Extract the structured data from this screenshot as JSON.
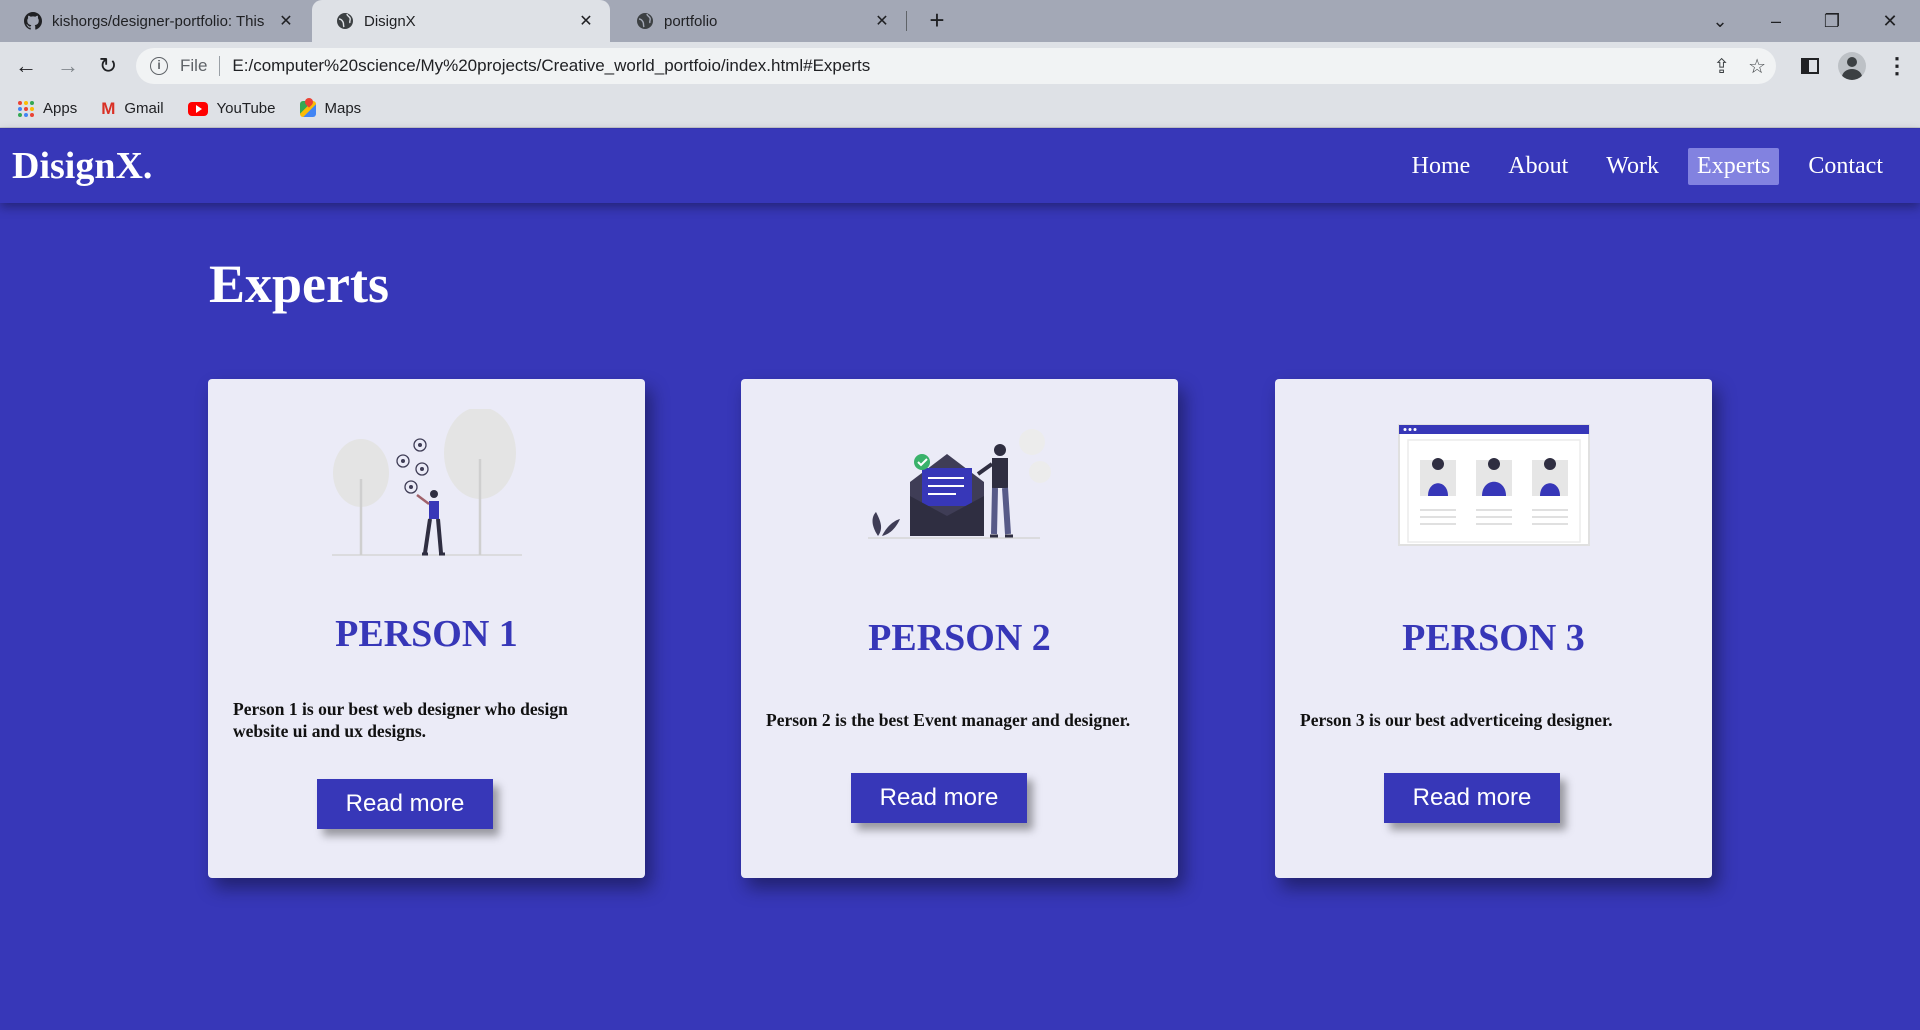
{
  "browser": {
    "tabs": [
      {
        "title": "kishorgs/designer-portfolio: This",
        "icon": "github-icon"
      },
      {
        "title": "DisignX",
        "icon": "globe-icon"
      },
      {
        "title": "portfolio",
        "icon": "globe-icon"
      }
    ],
    "address": {
      "scheme_label": "File",
      "url": "E:/computer%20science/My%20projects/Creative_world_portfoio/index.html#Experts"
    },
    "bookmarks": [
      {
        "label": "Apps",
        "icon": "apps-grid-icon"
      },
      {
        "label": "Gmail",
        "icon": "gmail-icon"
      },
      {
        "label": "YouTube",
        "icon": "youtube-icon"
      },
      {
        "label": "Maps",
        "icon": "maps-icon"
      }
    ]
  },
  "site": {
    "logo": "DisignX.",
    "nav": [
      "Home",
      "About",
      "Work",
      "Experts",
      "Contact"
    ],
    "active_nav": "Experts",
    "accent": "#3737b8",
    "card_bg": "#ebebf7"
  },
  "experts": {
    "title": "Experts",
    "cards": [
      {
        "name": "PERSON 1",
        "desc": "Person 1 is our best web designer who design website ui and ux designs.",
        "button": "Read more",
        "illustration": "social-media-illustration"
      },
      {
        "name": "PERSON 2",
        "desc": "Person 2 is the best Event manager and designer.",
        "button": "Read more",
        "illustration": "envelope-mail-illustration"
      },
      {
        "name": "PERSON 3",
        "desc": "Person 3 is our best adverticeing designer.",
        "button": "Read more",
        "illustration": "team-profiles-illustration"
      }
    ]
  }
}
